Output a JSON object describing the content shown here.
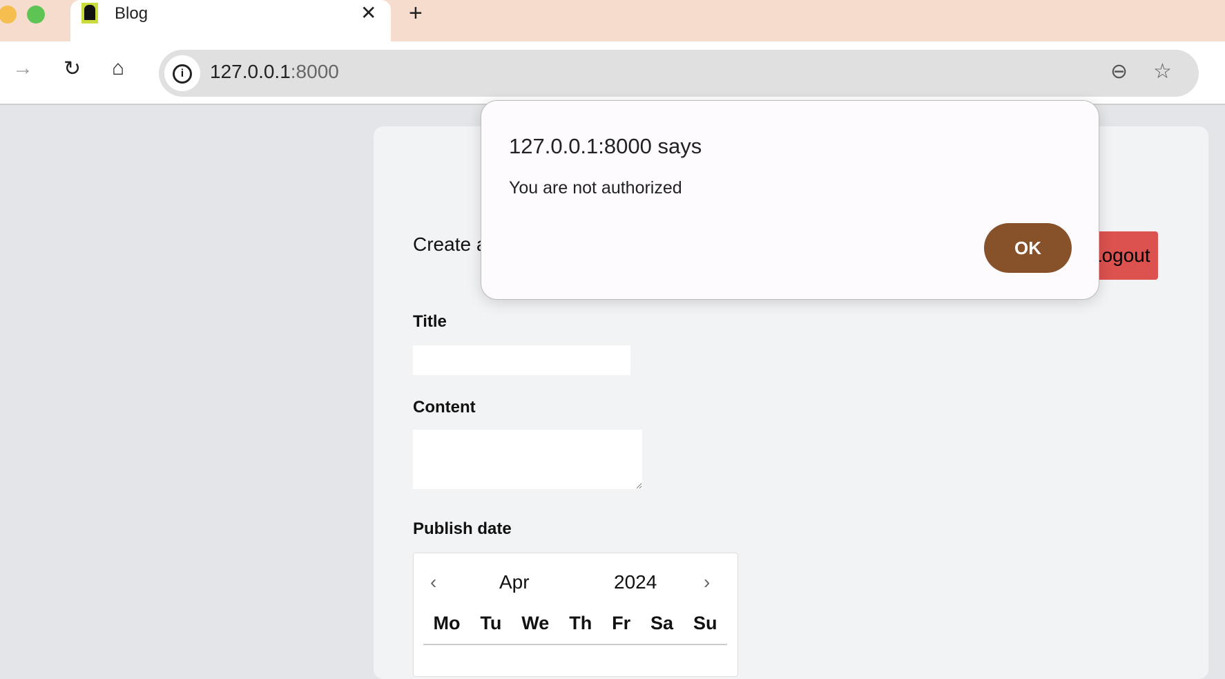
{
  "browser": {
    "tab_title": "Blog",
    "url_host": "127.0.0.1",
    "url_port": ":8000"
  },
  "page": {
    "heading": "Create a",
    "logout": "Logout",
    "title_label": "Title",
    "content_label": "Content",
    "publish_label": "Publish date",
    "calendar": {
      "month": "Apr",
      "year": "2024",
      "days": [
        "Mo",
        "Tu",
        "We",
        "Th",
        "Fr",
        "Sa",
        "Su"
      ]
    }
  },
  "dialog": {
    "title": "127.0.0.1:8000 says",
    "message": "You are not authorized",
    "ok": "OK"
  }
}
